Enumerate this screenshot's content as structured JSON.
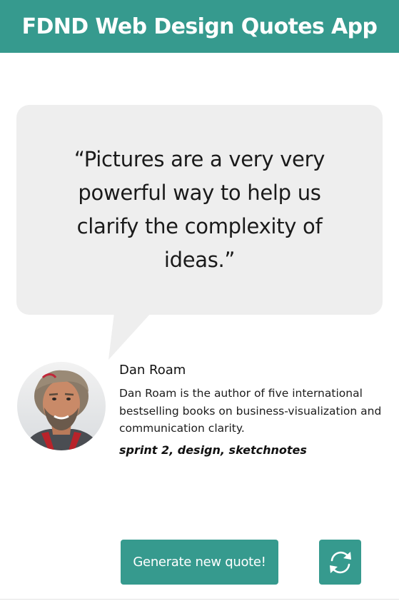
{
  "header": {
    "title": "FDND Web Design Quotes App"
  },
  "quote": {
    "text": "“Pictures are a very very powerful way to help us clarify the complexity of ideas.”"
  },
  "author": {
    "name": "Dan Roam",
    "bio": "Dan Roam is the author of five international bestselling books on business-visualization and communication clarity.",
    "tags": "sprint 2, design, sketchnotes",
    "avatar_icon": "author-photo"
  },
  "actions": {
    "generate_label": "Generate new quote!",
    "refresh_icon": "refresh-icon"
  },
  "colors": {
    "accent": "#369a8e",
    "bubble": "#eeeeee",
    "text": "#111111"
  }
}
